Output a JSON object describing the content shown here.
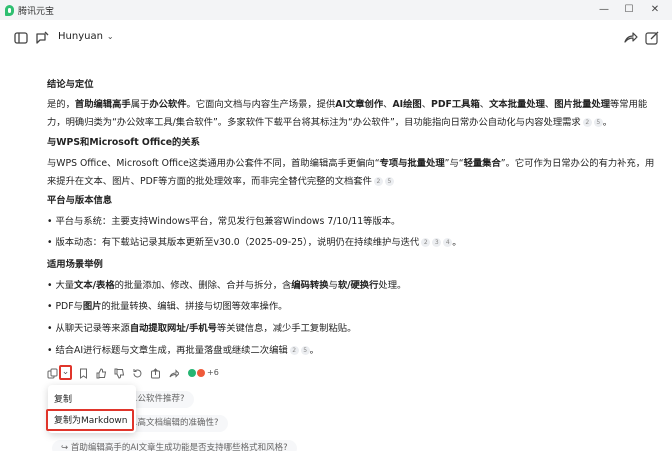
{
  "window": {
    "title": "腾讯元宝",
    "minimize": "—",
    "maximize": "☐",
    "close": "✕"
  },
  "header": {
    "model": "Hunyuan",
    "icons": [
      "sidebar-icon",
      "new-chat-icon",
      "share-icon",
      "compose-icon"
    ]
  },
  "content": {
    "sec1_title": "结论与定位",
    "sec1_p1a": "是的，",
    "sec1_p1b": "首助编辑高手",
    "sec1_p1c": "属于",
    "sec1_p1d": "办公软件",
    "sec1_p1e": "。它面向文档与内容生产场景，提供",
    "sec1_p1f": "AI文章创作",
    "sec1_p1g": "、",
    "sec1_p1h": "AI绘图",
    "sec1_p1i": "、",
    "sec1_p1j": "PDF工具箱",
    "sec1_p1k": "、",
    "sec1_p1l": "文本批量处理",
    "sec1_p1m": "、",
    "sec1_p1n": "图片批量处理",
    "sec1_p1o": "等常用能",
    "sec1_p2": "力，明确归类为“办公效率工具/集合软件”。多家软件下载平台将其标注为“办公软件”，目功能指向日常办公自动化与内容处理需求",
    "sec2_title": "与WPS和Microsoft Office的关系",
    "sec2_p1a": "与WPS Office、Microsoft Office这类通用办公套件不同，首助编辑高手更偏向“",
    "sec2_p1b": "专项与批量处理",
    "sec2_p1c": "”与“",
    "sec2_p1d": "轻量集合",
    "sec2_p1e": "”。它可作为日常办公的有力补充，用",
    "sec2_p2": "来提升在文本、图片、PDF等方面的批处理效率，而非完全替代完整的文档套件",
    "sec3_title": "平台与版本信息",
    "sec3_item1": "• 平台与系统：主要支持Windows平台，常见发行包兼容Windows 7/10/11等版本。",
    "sec3_item2": "• 版本动态：有下载站记录其版本更新至v30.0（2025-09-25），说明仍在持续维护与迭代",
    "sec4_title": "适用场景举例",
    "sec4_item1a": "• 大量",
    "sec4_item1b": "文本/表格",
    "sec4_item1c": "的批量添加、修改、删除、合并与拆分，含",
    "sec4_item1d": "编码转换",
    "sec4_item1e": "与",
    "sec4_item1f": "软/硬换行",
    "sec4_item1g": "处理。",
    "sec4_item2a": "• PDF与",
    "sec4_item2b": "图片",
    "sec4_item2c": "的批量转换、编辑、拼接与切图等效率操作。",
    "sec4_item3a": "• 从聊天记录等来源",
    "sec4_item3b": "自动提取网址/手机号",
    "sec4_item3c": "等关键信息，减少手工复制粘贴。",
    "sec4_item4": "• 结合AI进行标题与文章生成，再批量落盘或继续二次编辑",
    "refs": {
      "r1a": "2",
      "r1b": "5",
      "r2a": "2",
      "r2b": "5",
      "r3a": "2",
      "r3b": "3",
      "r3c": "4",
      "r4a": "2",
      "r4b": "5"
    }
  },
  "toolbar": {
    "more_label": "⌄",
    "badge": "+6"
  },
  "suggestions": {
    "s1": "…公软件推荐?",
    "s2": "…高文档编辑的准确性?",
    "s3": "↪ 首助编辑高手的AI文章生成功能是否支持哪些格式和风格?"
  },
  "menu": {
    "copy": "复制",
    "copy_markdown": "复制为Markdown"
  }
}
